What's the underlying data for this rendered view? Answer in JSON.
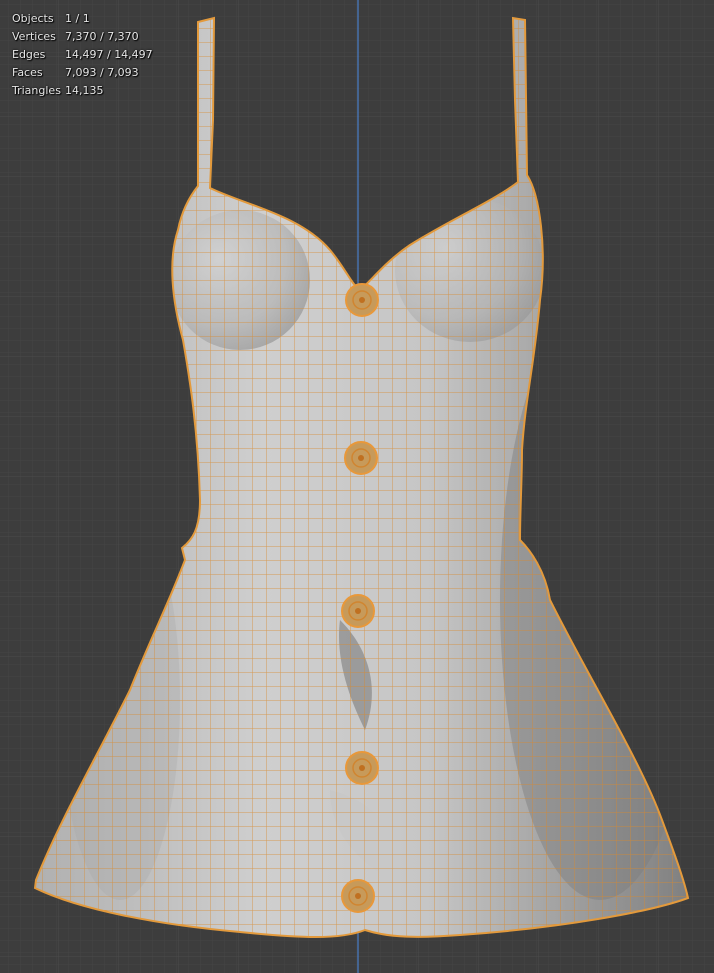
{
  "viewport": {
    "background": "#3d3d3d",
    "grid_minor_color": "#454545",
    "grid_major_color": "#4d4d4d",
    "axis_color": "#4a7ec8",
    "mesh_fill": "#bfbfbf",
    "wire_color": "#e8983a",
    "object": "sleeveless button-front dress mesh (edit mode wireframe)"
  },
  "stats": [
    {
      "label": "Objects",
      "value": "1 / 1"
    },
    {
      "label": "Vertices",
      "value": "7,370 / 7,370"
    },
    {
      "label": "Edges",
      "value": "14,497 / 14,497"
    },
    {
      "label": "Faces",
      "value": "7,093 / 7,093"
    },
    {
      "label": "Triangles",
      "value": "14,135"
    }
  ]
}
